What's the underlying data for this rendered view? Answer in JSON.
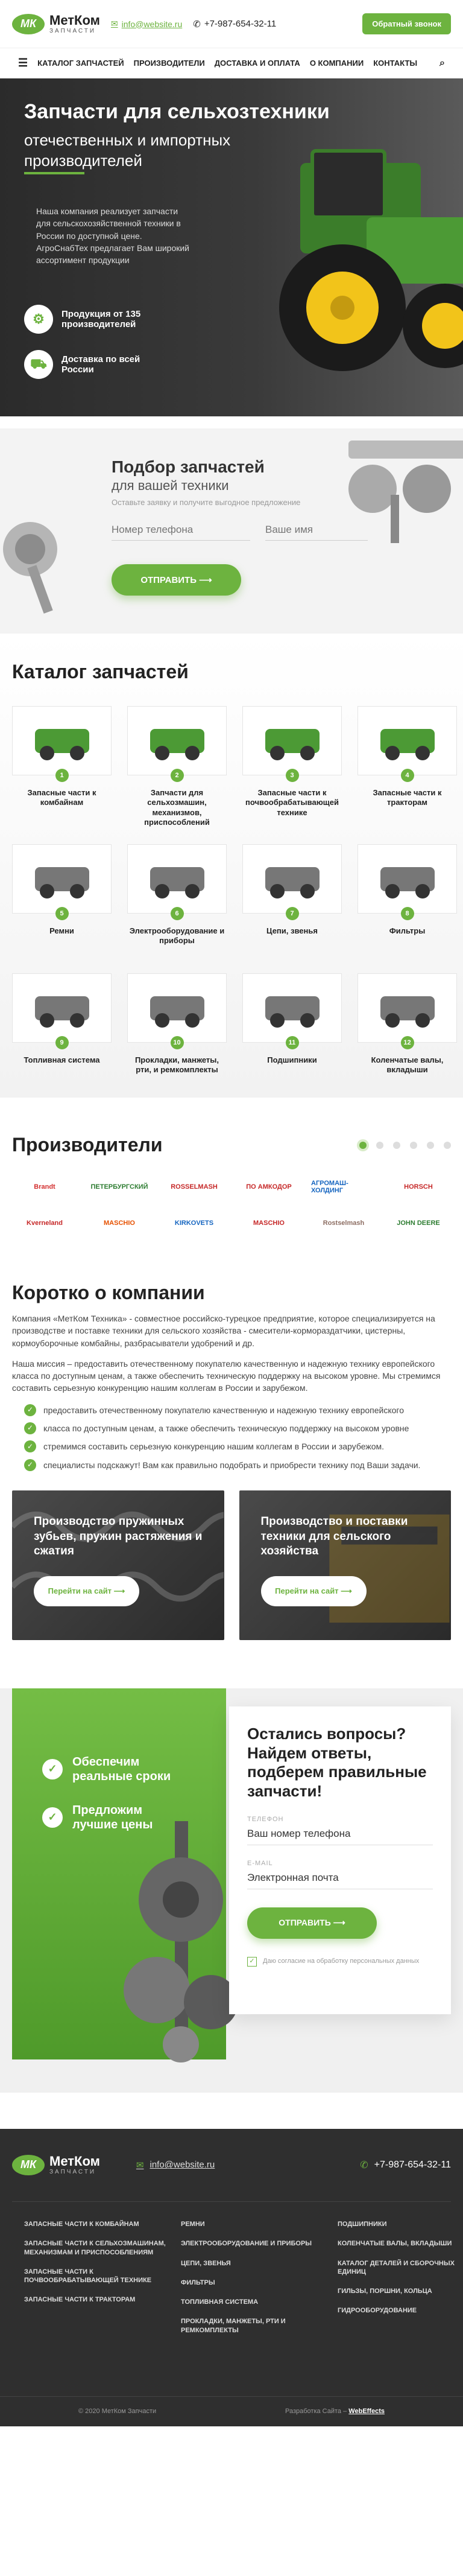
{
  "header": {
    "logo_badge": "МК",
    "logo_name": "МетКом",
    "logo_sub": "ЗАПЧАСТИ",
    "email": "info@website.ru",
    "phone": "+7-987-654-32-11",
    "callback_btn": "Обратный звонок"
  },
  "nav": {
    "items": [
      "КАТАЛОГ ЗАПЧАСТЕЙ",
      "ПРОИЗВОДИТЕЛИ",
      "ДОСТАВКА И ОПЛАТА",
      "О КОМПАНИИ",
      "КОНТАКТЫ"
    ]
  },
  "hero": {
    "title": "Запчасти для сельхозтехники",
    "subtitle": "отечественных и импортных производителей",
    "desc": "Наша компания реализует запчасти для сельскохозяйственной техники в России по доступной цене. АгроСнабТех предлагает Вам широкий ассортимент продукции",
    "features": [
      "Продукция от 135 производителей",
      "Доставка по всей России"
    ]
  },
  "request": {
    "title": "Подбор запчастей",
    "subtitle": "для вашей техники",
    "hint": "Оставьте заявку и получите выгодное предложение",
    "phone_placeholder": "Номер телефона",
    "name_placeholder": "Ваше имя",
    "send_btn": "ОТПРАВИТЬ ⟶"
  },
  "catalog": {
    "title": "Каталог запчастей",
    "items": [
      {
        "num": "1",
        "label": "Запасные части к комбайнам"
      },
      {
        "num": "2",
        "label": "Запчасти для сельхозмашин, механизмов, приспособлений"
      },
      {
        "num": "3",
        "label": "Запасные части к почвообрабатывающей технике"
      },
      {
        "num": "4",
        "label": "Запасные части к тракторам"
      },
      {
        "num": "5",
        "label": "Ремни"
      },
      {
        "num": "6",
        "label": "Электрооборудование и приборы"
      },
      {
        "num": "7",
        "label": "Цепи, звенья"
      },
      {
        "num": "8",
        "label": "Фильтры"
      },
      {
        "num": "9",
        "label": "Топливная система"
      },
      {
        "num": "10",
        "label": "Прокладки, манжеты, рти, и ремкомплекты"
      },
      {
        "num": "11",
        "label": "Подшипники"
      },
      {
        "num": "12",
        "label": "Коленчатые валы, вкладыши"
      }
    ]
  },
  "manufacturers": {
    "title": "Производители",
    "brands": [
      {
        "name": "Brandt",
        "color": "#d32f2f"
      },
      {
        "name": "ПЕТЕРБУРГСКИЙ",
        "color": "#2e7d32"
      },
      {
        "name": "ROSSELMASH",
        "color": "#c62828"
      },
      {
        "name": "ПО АМКОДОР",
        "color": "#c62828"
      },
      {
        "name": "АГРОМАШ-ХОЛДИНГ",
        "color": "#1565c0"
      },
      {
        "name": "HORSCH",
        "color": "#c62828"
      },
      {
        "name": "Kverneland",
        "color": "#c62828"
      },
      {
        "name": "MASCHIO",
        "color": "#e65100"
      },
      {
        "name": "KIRKOVETS",
        "color": "#1565c0"
      },
      {
        "name": "MASCHIO",
        "color": "#c62828"
      },
      {
        "name": "Rostselmash",
        "color": "#8d6e63"
      },
      {
        "name": "JOHN DEERE",
        "color": "#2e7d32"
      }
    ],
    "active_slide": 1,
    "slide_count": 6
  },
  "about": {
    "title": "Коротко о компании",
    "p1": "Компания «МетКом Техника» - совместное российско-турецкое предприятие, которое специализируется на производстве и поставке техники для сельского хозяйства - смесители-кормораздатчики, цистерны, кормоуборочные комбайны, разбрасыватели удобрений и др.",
    "p2": "Наша миссия – предоставить отечественному покупателю качественную и надежную технику европейского класса по доступным ценам, а также обеспечить техническую поддержку на высоком уровне. Мы стремимся составить серьезную конкуренцию нашим коллегам в России и зарубежом.",
    "list": [
      "предоставить отечественному покупателю качественную и надежную технику европейского",
      "класса по доступным ценам, а также обеспечить техническую поддержку на высоком уровне",
      "стремимся составить серьезную конкуренцию нашим коллегам в России и зарубежом.",
      "специалисты подскажут! Вам как правильно подобрать и приобрести технику под Ваши задачи."
    ],
    "promos": [
      {
        "title": "Производство пружинных зубьев, пружин растяжения и сжатия",
        "btn": "Перейти на сайт ⟶"
      },
      {
        "title": "Производство и поставки техники для сельского хозяйства",
        "btn": "Перейти на сайт ⟶"
      }
    ]
  },
  "question": {
    "points": [
      "Обеспечим реальные сроки",
      "Предложим лучшие цены"
    ],
    "title_green": "Остались вопросы?",
    "title": "Найдем ответы, подберем правильные запчасти!",
    "phone_label": "ТЕЛЕФОН",
    "phone_value": "Ваш номер телефона",
    "email_label": "E-MAIL",
    "email_value": "Электронная почта",
    "submit_btn": "ОТПРАВИТЬ ⟶",
    "agree": "Даю согласие на обработку персональных данных"
  },
  "footer": {
    "email": "info@website.ru",
    "phone": "+7-987-654-32-11",
    "col1": [
      "ЗАПАСНЫЕ ЧАСТИ К КОМБАЙНАМ",
      "ЗАПАСНЫЕ ЧАСТИ К СЕЛЬХОЗМАШИНАМ, МЕХАНИЗМАМ И ПРИСПОСОБЛЕНИЯМ",
      "ЗАПАСНЫЕ ЧАСТИ К ПОЧВООБРАБАТЫВАЮЩЕЙ ТЕХНИКЕ",
      "ЗАПАСНЫЕ ЧАСТИ К ТРАКТОРАМ"
    ],
    "col2": [
      "РЕМНИ",
      "ЭЛЕКТРООБОРУДОВАНИЕ И ПРИБОРЫ",
      "ЦЕПИ, ЗВЕНЬЯ",
      "ФИЛЬТРЫ",
      "ТОПЛИВНАЯ СИСТЕМА",
      "ПРОКЛАДКИ, МАНЖЕТЫ, РТИ И РЕМКОМПЛЕКТЫ"
    ],
    "col3": [
      "ПОДШИПНИКИ",
      "КОЛЕНЧАТЫЕ ВАЛЫ, ВКЛАДЫШИ",
      "КАТАЛОГ ДЕТАЛЕЙ И СБОРОЧНЫХ ЕДИНИЦ",
      "ГИЛЬЗЫ, ПОРШНИ, КОЛЬЦА",
      "ГИДРООБОРУДОВАНИЕ"
    ],
    "copyright": "© 2020 МетКом Запчасти",
    "dev_label": "Разработка Сайта –",
    "dev_name": "WebEffects"
  },
  "colors": {
    "accent": "#6db33f",
    "dark": "#2f2f2f"
  }
}
